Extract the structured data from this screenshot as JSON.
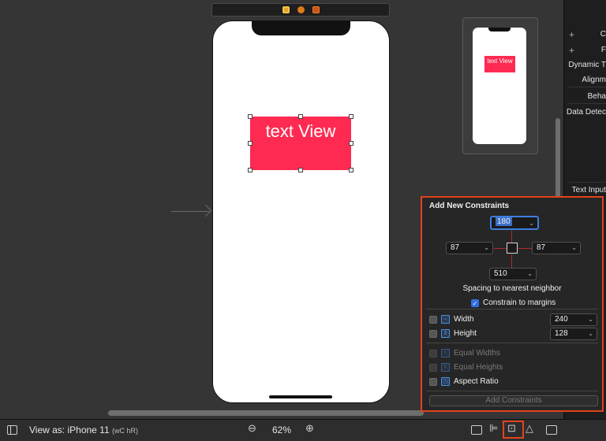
{
  "canvas": {
    "text_view_label": "text View",
    "minimap_text_view_label": "text View"
  },
  "inspector": {
    "rows": [
      "C",
      "F",
      "Dynamic T",
      "Alignm",
      "Beha",
      "Data Detec",
      "Text Input"
    ]
  },
  "constraints": {
    "title": "Add New Constraints",
    "top": "180",
    "left": "87",
    "right": "87",
    "bottom": "510",
    "spacing_label": "Spacing to nearest neighbor",
    "constrain_margins_label": "Constrain to margins",
    "constrain_margins_checked": true,
    "width_label": "Width",
    "width_value": "240",
    "height_label": "Height",
    "height_value": "128",
    "equal_widths_label": "Equal Widths",
    "equal_heights_label": "Equal Heights",
    "aspect_ratio_label": "Aspect Ratio",
    "add_button_label": "Add Constraints"
  },
  "bottom_bar": {
    "view_as_label": "View as: iPhone 11",
    "traits": "(wC hR)",
    "zoom": "62%",
    "zoom_out_icon": "zoom-out-icon",
    "zoom_in_icon": "zoom-in-icon"
  },
  "colors": {
    "accent_highlight": "#e0431e",
    "text_view_bg": "#fe2a52",
    "checkbox_blue": "#2f6fe0"
  }
}
